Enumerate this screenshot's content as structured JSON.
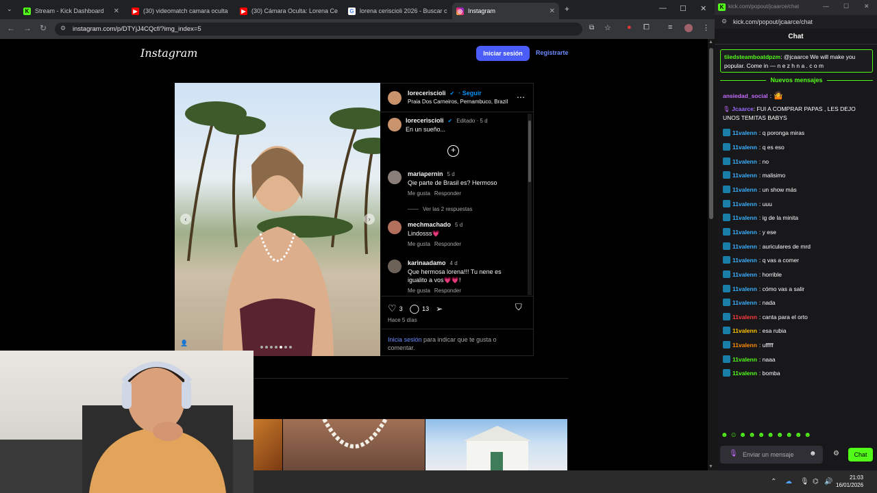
{
  "browser": {
    "tabs": [
      {
        "label": "Stream - Kick Dashboard",
        "icon": "kick-icon",
        "active": false
      },
      {
        "label": "(30) videomatch camara oculta",
        "icon": "youtube-icon",
        "active": false
      },
      {
        "label": "(30) Cámara Oculta: Lorena Ce",
        "icon": "youtube-icon",
        "active": false
      },
      {
        "label": "lorena ceriscioli 2026 - Buscar c",
        "icon": "google-icon",
        "active": false
      },
      {
        "label": "Instagram",
        "icon": "instagram-icon",
        "active": true
      }
    ],
    "url": "instagram.com/p/DTYjJ4CQcf/?img_index=5"
  },
  "instagram": {
    "logo": "Instagram",
    "login_label": "Iniciar sesión",
    "signup_label": "Registrarte",
    "post": {
      "author": "loreceriscioli",
      "follow_label": "Seguir",
      "location": "Praia Dos Carneiros, Pernambuco, Brazil",
      "caption_meta": "Editado · 5 d",
      "caption": "En un sueño...",
      "comments": [
        {
          "user": "mariapernin",
          "time": "5 d",
          "text": "Qie parte de Brasil es? Hermoso",
          "like": "Me gusta",
          "reply": "Responder",
          "replies": "Ver las 2 respuestas"
        },
        {
          "user": "mechmachado",
          "time": "5 d",
          "text": "Lindosss💗",
          "like": "Me gusta",
          "reply": "Responder",
          "replies": ""
        },
        {
          "user": "karinaadamo",
          "time": "4 d",
          "text": "Que hermosa lorena!!! Tu nene es igualito a vos💗💗!",
          "like": "Me gusta",
          "reply": "Responder",
          "replies": ""
        }
      ],
      "likes": "3",
      "comments_count": "13",
      "posted": "Hace 5 días",
      "login_prompt_link": "Inicia sesión",
      "login_prompt_rest": "para indicar que te gusta o comentar."
    }
  },
  "chat": {
    "url": "kick.com/popout/jcaarce/chat",
    "title": "Chat",
    "pinned": "tiiedsteamboatdpzm: @jcaarce We will make you popular. Come in — n e z h n a . c o m",
    "pinned_user": "tiiedsteamboatdpzm",
    "pinned_text": ": @jcaarce We will make you popular. Come in — n e z h n a . c o m",
    "new_messages": "Nuevos mensajes",
    "messages": [
      {
        "user": "ansiedad_social",
        "text": ":",
        "color": "#c56bff"
      },
      {
        "user": "Jcaarce",
        "text": ": FUI A COMPRAR PAPAS , LES DEJO UNOS TEMITAS BABYS",
        "color": "#9b6bff"
      },
      {
        "user": "11valenn",
        "text": ": q poronga miras",
        "color": "#3cb0ff"
      },
      {
        "user": "11valenn",
        "text": ": q es eso",
        "color": "#3cb0ff"
      },
      {
        "user": "11valenn",
        "text": ": no",
        "color": "#3cb0ff"
      },
      {
        "user": "11valenn",
        "text": ": malisimo",
        "color": "#3cb0ff"
      },
      {
        "user": "11valenn",
        "text": ": un show más",
        "color": "#3cb0ff"
      },
      {
        "user": "11valenn",
        "text": ": uuu",
        "color": "#3cb0ff"
      },
      {
        "user": "11valenn",
        "text": ": ig de la minita",
        "color": "#3cb0ff"
      },
      {
        "user": "11valenn",
        "text": ": y ese",
        "color": "#3cb0ff"
      },
      {
        "user": "11valenn",
        "text": ": auriculares de mrd",
        "color": "#3cb0ff"
      },
      {
        "user": "11valenn",
        "text": ": q vas a comer",
        "color": "#3cb0ff"
      },
      {
        "user": "11valenn",
        "text": ": horrible",
        "color": "#3cb0ff"
      },
      {
        "user": "11valenn",
        "text": ": cómo vas a salir",
        "color": "#3cb0ff"
      },
      {
        "user": "11valenn",
        "text": ": nada",
        "color": "#3cb0ff"
      },
      {
        "user": "11valenn",
        "text": ": canta para el orto",
        "color": "#ff3b3b"
      },
      {
        "user": "11valenn",
        "text": ": esa rubia",
        "color": "#ffc400"
      },
      {
        "user": "11valenn",
        "text": ": ufffff",
        "color": "#ff8c00"
      },
      {
        "user": "11valenn",
        "text": ": naaa",
        "color": "#53fc18"
      },
      {
        "user": "11valenn",
        "text": ": bomba",
        "color": "#53fc18"
      }
    ],
    "input_placeholder": "Enviar un mensaje",
    "send_label": "Chat"
  },
  "taskbar": {
    "time": "21:03",
    "date": "16/01/2026"
  }
}
